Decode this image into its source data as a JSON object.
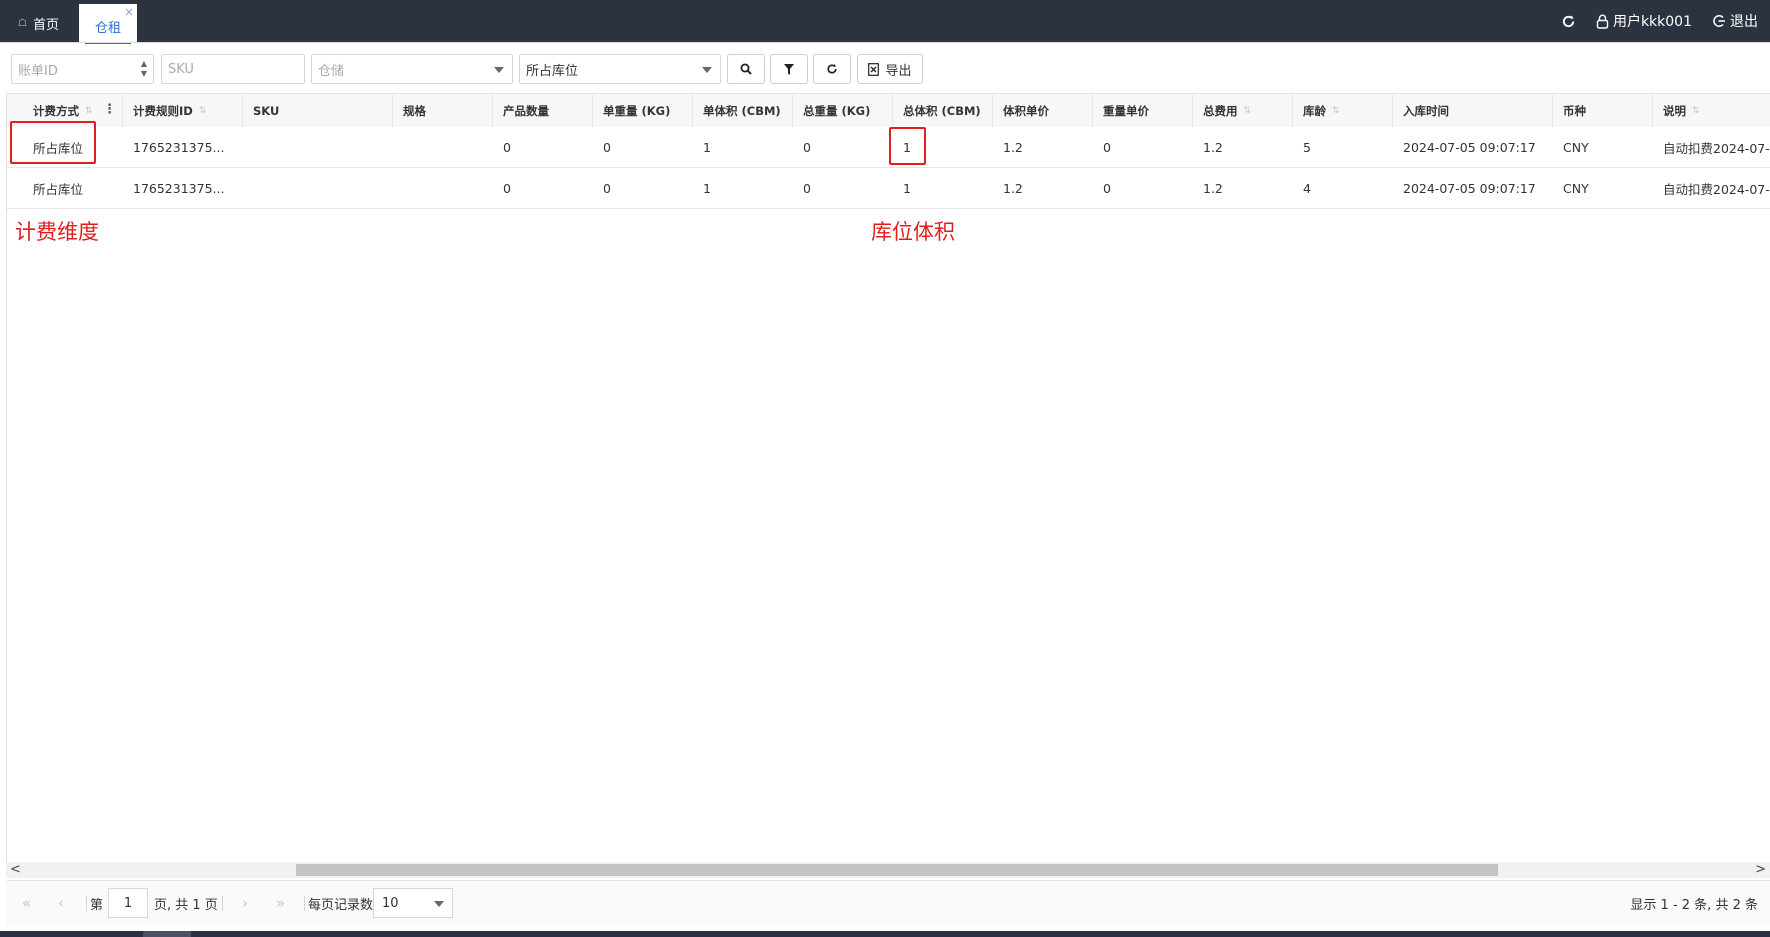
{
  "tabs": {
    "home_label": "首页",
    "active_label": "仓租",
    "close_glyph": "×"
  },
  "header": {
    "user_label": "用户kkk001",
    "logout_label": "退出"
  },
  "filters": {
    "bill_id_placeholder": "账单ID",
    "sku_placeholder": "SKU",
    "warehouse_placeholder": "仓储",
    "billing_mode_value": "所占库位",
    "export_label": "导出"
  },
  "table": {
    "columns": [
      "计费方式",
      "计费规则ID",
      "SKU",
      "规格",
      "产品数量",
      "单重量 (KG)",
      "单体积 (CBM)",
      "总重量 (KG)",
      "总体积 (CBM)",
      "体积单价",
      "重量单价",
      "总费用",
      "库龄",
      "入库时间",
      "币种",
      "说明"
    ],
    "rows": [
      [
        "所占库位",
        "1765231375...",
        "",
        "",
        "0",
        "0",
        "1",
        "0",
        "1",
        "1.2",
        "0",
        "1.2",
        "5",
        "2024-07-05 09:07:17",
        "CNY",
        "自动扣费2024-07-"
      ],
      [
        "所占库位",
        "1765231375...",
        "",
        "",
        "0",
        "0",
        "1",
        "0",
        "1",
        "1.2",
        "0",
        "1.2",
        "4",
        "2024-07-05 09:07:17",
        "CNY",
        "自动扣费2024-07-"
      ]
    ]
  },
  "annotations": {
    "billing_dimension": "计费维度",
    "location_volume": "库位体积"
  },
  "pager": {
    "page_prefix": "第",
    "page_value": "1",
    "page_suffix": "页, 共 1 页",
    "per_page_label": "每页记录数",
    "per_page_value": "10",
    "summary": "显示 1 - 2 条, 共 2 条"
  },
  "colors": {
    "topbar": "#2b3340",
    "accent": "#2f6fd6",
    "annotation": "#e01e1e"
  }
}
